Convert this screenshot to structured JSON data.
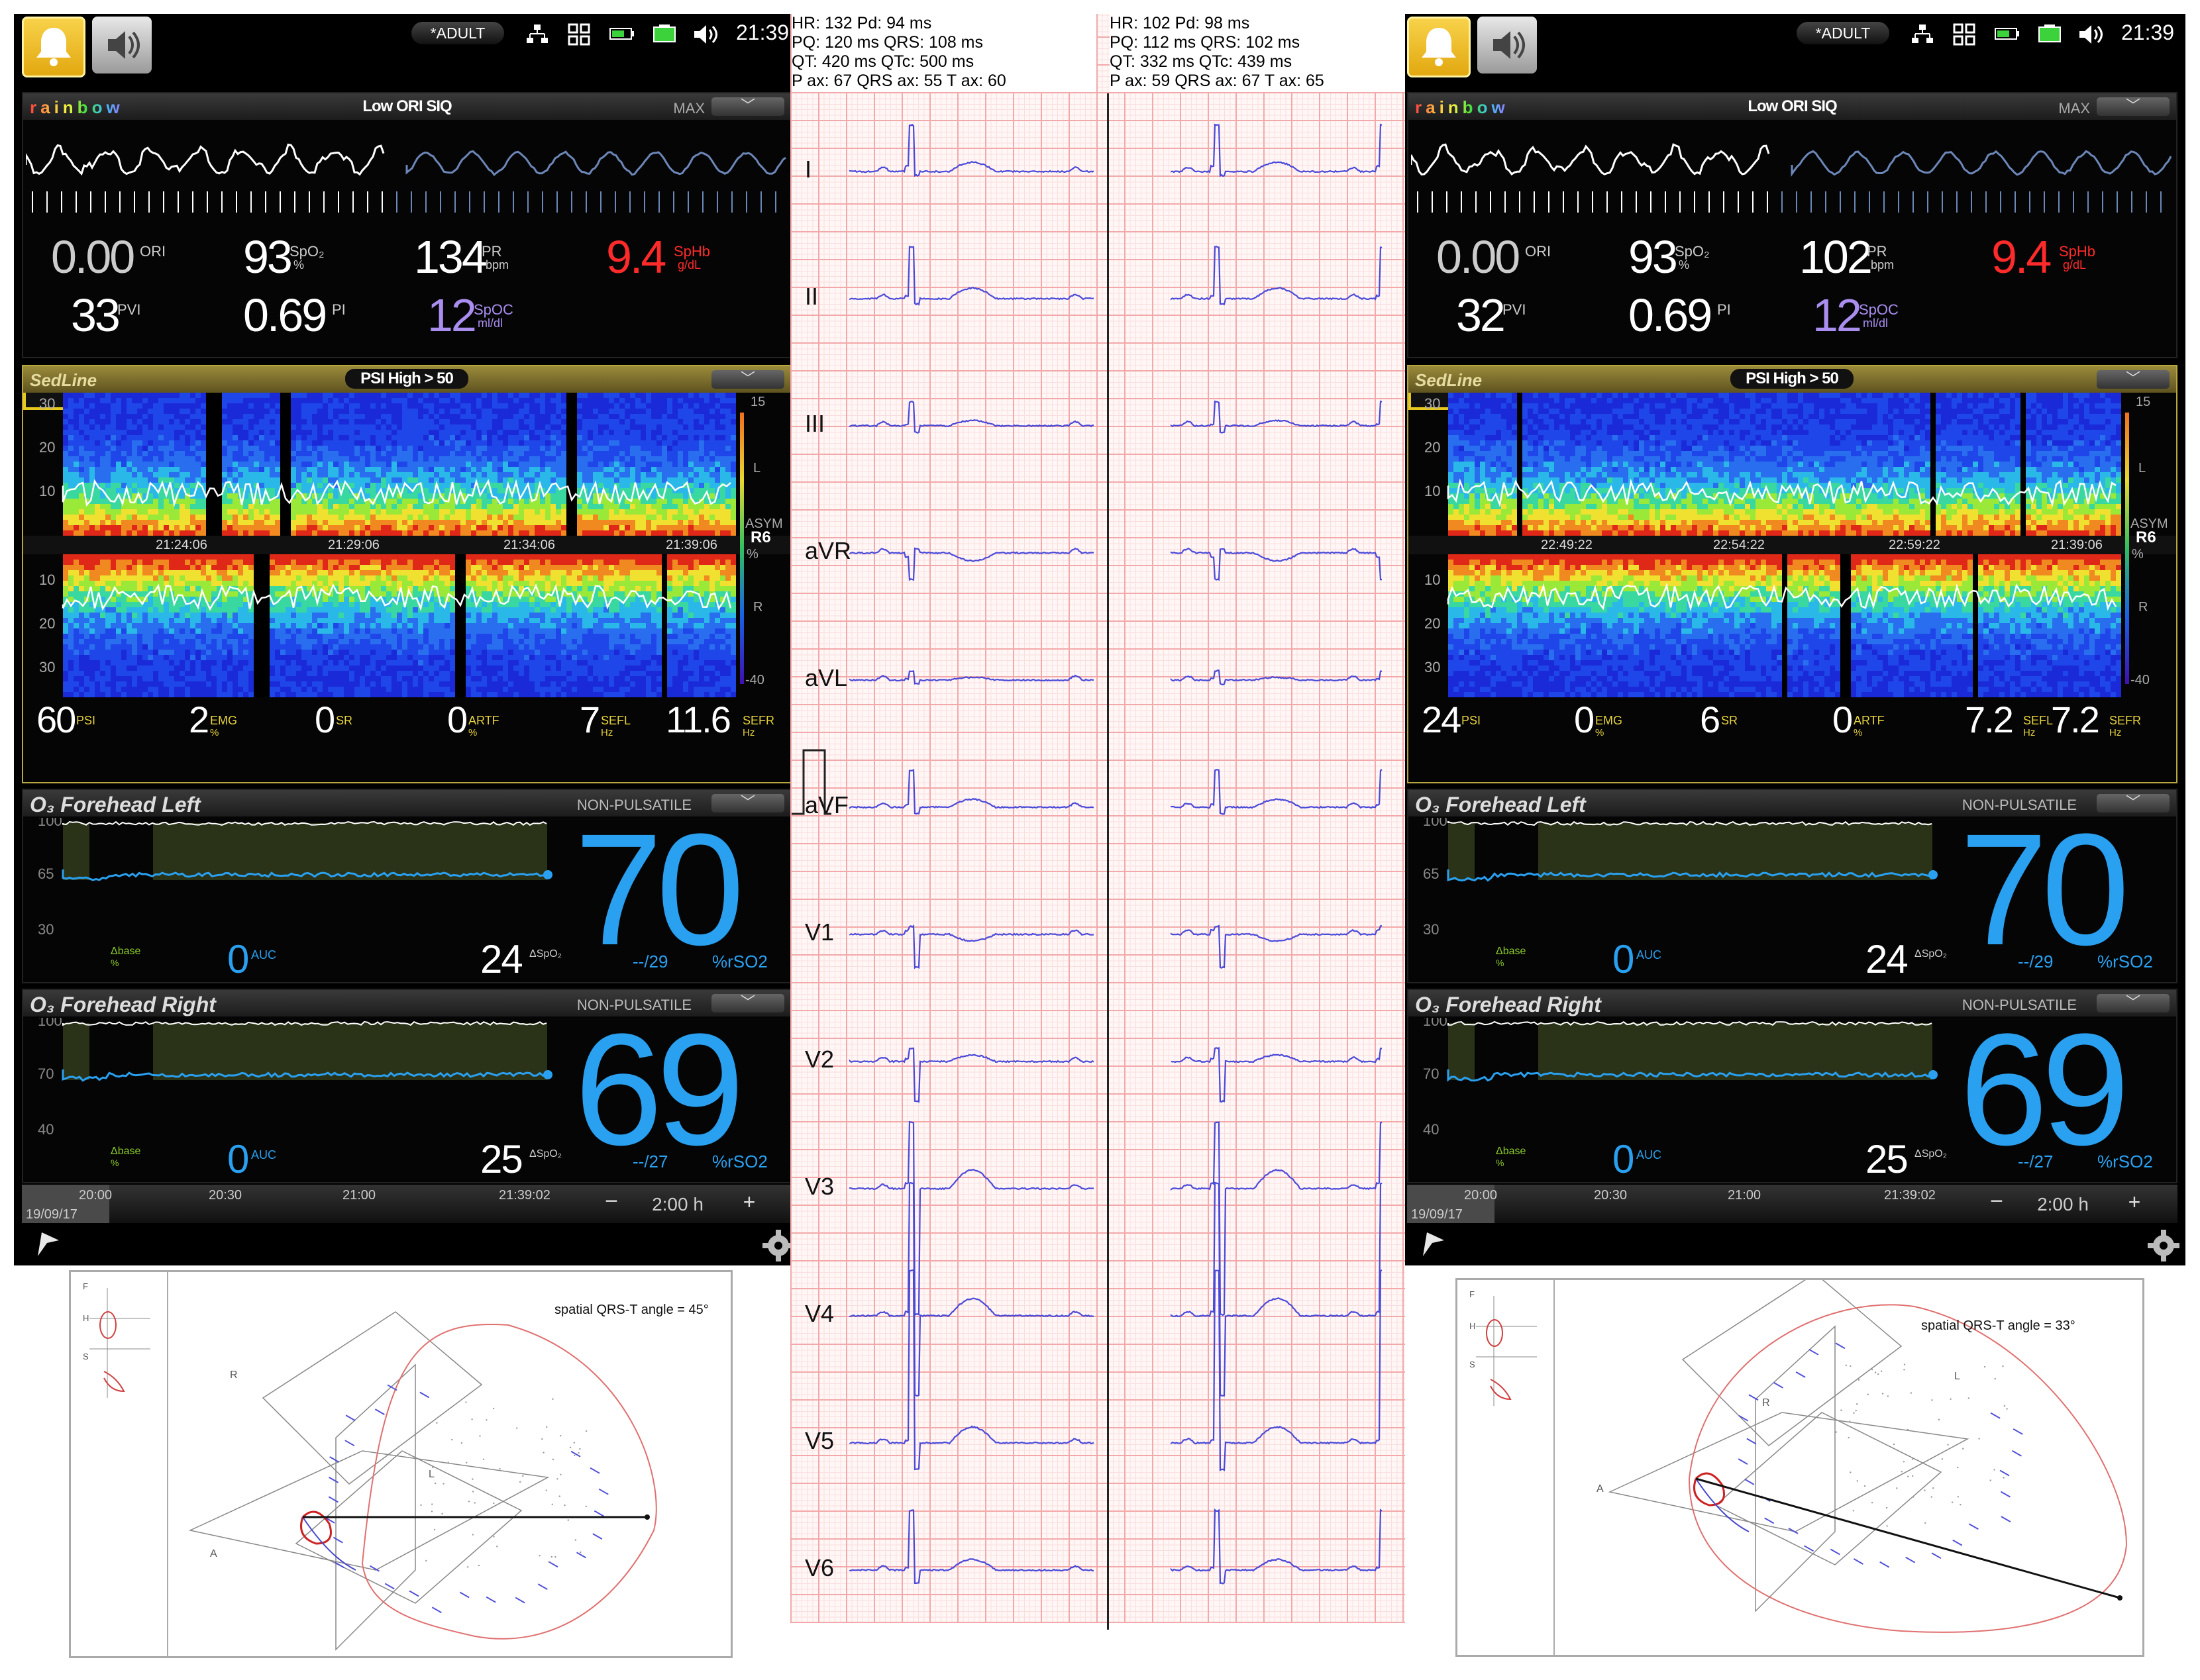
{
  "monitors": [
    {
      "status": {
        "mode": "*ADULT",
        "time": "21:39"
      },
      "rainbow": {
        "brand": "rainbow",
        "title": "Low ORI SIQ",
        "max_label": "MAX",
        "params": [
          {
            "value": "0.00",
            "label": "ORI",
            "unit": "",
            "color": "#cccccc"
          },
          {
            "value": "93",
            "label": "SpO₂",
            "unit": "%",
            "color": "#ffffff"
          },
          {
            "value": "134",
            "label": "PR",
            "unit": "bpm",
            "color": "#ffffff"
          },
          {
            "value": "9.4",
            "label": "SpHb",
            "unit": "g/dL",
            "color": "#ff2a2a"
          },
          {
            "value": "33",
            "label": "PVI",
            "unit": "",
            "color": "#ffffff"
          },
          {
            "value": "0.69",
            "label": "PI",
            "unit": "",
            "color": "#ffffff"
          },
          {
            "value": "12",
            "label": "SpOC",
            "unit": "ml/dl",
            "color": "#a98ef0"
          }
        ]
      },
      "sedline": {
        "brand": "SedLine",
        "alarm": "PSI High > 50",
        "scale_top": [
          "30",
          "20",
          "10"
        ],
        "scale_bottom": [
          "10",
          "20",
          "30"
        ],
        "times": [
          "21:24:06",
          "21:29:06",
          "21:34:06",
          "21:39:06"
        ],
        "side": {
          "top": "15",
          "l": "L",
          "asym": "ASYM",
          "r6": "R6",
          "pct": "%",
          "r": "R",
          "bottom": "-40"
        },
        "params": [
          {
            "value": "60",
            "label": "PSI",
            "unit": ""
          },
          {
            "value": "2",
            "label": "EMG",
            "unit": "%"
          },
          {
            "value": "0",
            "label": "SR",
            "unit": ""
          },
          {
            "value": "0",
            "label": "ARTF",
            "unit": "%"
          },
          {
            "value": "7",
            "label": "SEFL",
            "unit": "Hz"
          },
          {
            "value": "11.6",
            "label": "SEFR",
            "unit": "Hz"
          }
        ]
      },
      "o3": [
        {
          "name": "O₃ Forehead Left",
          "status": "NON-PULSATILE",
          "scale": [
            "100",
            "65",
            "30"
          ],
          "value": "70",
          "auc": "0",
          "auc_label": "AUC",
          "delta": "24",
          "delta_label": "ΔSpO₂",
          "base": "Δbase",
          "base_unit": "%",
          "limit": "--/29",
          "unit": "%rSO2"
        },
        {
          "name": "O₃ Forehead Right",
          "status": "NON-PULSATILE",
          "scale": [
            "100",
            "70",
            "40"
          ],
          "value": "69",
          "auc": "0",
          "auc_label": "AUC",
          "delta": "25",
          "delta_label": "ΔSpO₂",
          "base": "Δbase",
          "base_unit": "%",
          "limit": "--/27",
          "unit": "%rSO2"
        }
      ],
      "timeline": {
        "ticks": [
          "20:00",
          "20:30",
          "21:00",
          "21:39:02"
        ],
        "date": "19/09/17",
        "minus": "−",
        "span": "2:00 h",
        "plus": "+"
      },
      "vcg_angle": "spatial QRS-T angle = 45°"
    },
    {
      "status": {
        "mode": "*ADULT",
        "time": "21:39"
      },
      "rainbow": {
        "brand": "rainbow",
        "title": "Low ORI SIQ",
        "max_label": "MAX",
        "params": [
          {
            "value": "0.00",
            "label": "ORI",
            "unit": "",
            "color": "#cccccc"
          },
          {
            "value": "93",
            "label": "SpO₂",
            "unit": "%",
            "color": "#ffffff"
          },
          {
            "value": "102",
            "label": "PR",
            "unit": "bpm",
            "color": "#ffffff"
          },
          {
            "value": "9.4",
            "label": "SpHb",
            "unit": "g/dL",
            "color": "#ff2a2a"
          },
          {
            "value": "32",
            "label": "PVI",
            "unit": "",
            "color": "#ffffff"
          },
          {
            "value": "0.69",
            "label": "PI",
            "unit": "",
            "color": "#ffffff"
          },
          {
            "value": "12",
            "label": "SpOC",
            "unit": "ml/dl",
            "color": "#a98ef0"
          }
        ]
      },
      "sedline": {
        "brand": "SedLine",
        "alarm": "PSI High > 50",
        "scale_top": [
          "30",
          "20",
          "10"
        ],
        "scale_bottom": [
          "10",
          "20",
          "30"
        ],
        "times": [
          "22:49:22",
          "22:54:22",
          "22:59:22",
          "21:39:06"
        ],
        "side": {
          "top": "15",
          "l": "L",
          "asym": "ASYM",
          "r6": "R6",
          "pct": "%",
          "r": "R",
          "bottom": "-40"
        },
        "params": [
          {
            "value": "24",
            "label": "PSI",
            "unit": ""
          },
          {
            "value": "0",
            "label": "EMG",
            "unit": "%"
          },
          {
            "value": "6",
            "label": "SR",
            "unit": ""
          },
          {
            "value": "0",
            "label": "ARTF",
            "unit": "%"
          },
          {
            "value": "7.2",
            "label": "SEFL",
            "unit": "Hz"
          },
          {
            "value": "7.2",
            "label": "SEFR",
            "unit": "Hz"
          }
        ]
      },
      "o3": [
        {
          "name": "O₃ Forehead Left",
          "status": "NON-PULSATILE",
          "scale": [
            "100",
            "65",
            "30"
          ],
          "value": "70",
          "auc": "0",
          "auc_label": "AUC",
          "delta": "24",
          "delta_label": "ΔSpO₂",
          "base": "Δbase",
          "base_unit": "%",
          "limit": "--/29",
          "unit": "%rSO2"
        },
        {
          "name": "O₃ Forehead Right",
          "status": "NON-PULSATILE",
          "scale": [
            "100",
            "70",
            "40"
          ],
          "value": "69",
          "auc": "0",
          "auc_label": "AUC",
          "delta": "25",
          "delta_label": "ΔSpO₂",
          "base": "Δbase",
          "base_unit": "%",
          "limit": "--/27",
          "unit": "%rSO2"
        }
      ],
      "timeline": {
        "ticks": [
          "20:00",
          "20:30",
          "21:00",
          "21:39:02"
        ],
        "date": "19/09/17",
        "minus": "−",
        "span": "2:00 h",
        "plus": "+"
      },
      "vcg_angle": "spatial QRS-T angle = 33°"
    }
  ],
  "ecg": {
    "left": "HR: 132 Pd: 94 ms\nPQ: 120 ms QRS: 108 ms\nQT: 420 ms QTc: 500 ms\nP ax: 67 QRS ax: 55 T ax: 60",
    "right": "HR: 102 Pd: 98 ms\nPQ: 112 ms QRS: 102 ms\nQT: 332 ms QTc: 439 ms\nP ax: 59 QRS ax: 67 T ax: 65",
    "leads": [
      "I",
      "II",
      "III",
      "aVR",
      "aVL",
      "aVF",
      "V1",
      "V2",
      "V3",
      "V4",
      "V5",
      "V6"
    ]
  },
  "vcg_labels": {
    "f": "F",
    "h": "H",
    "s": "S",
    "r": "R",
    "a": "A",
    "l": "L"
  },
  "colors": {
    "accent_blue": "#2aa0f0",
    "alarm_yellow": "#f5c518",
    "sphb_red": "#ff2a2a",
    "ecg_trace": "#4a4ad8"
  }
}
